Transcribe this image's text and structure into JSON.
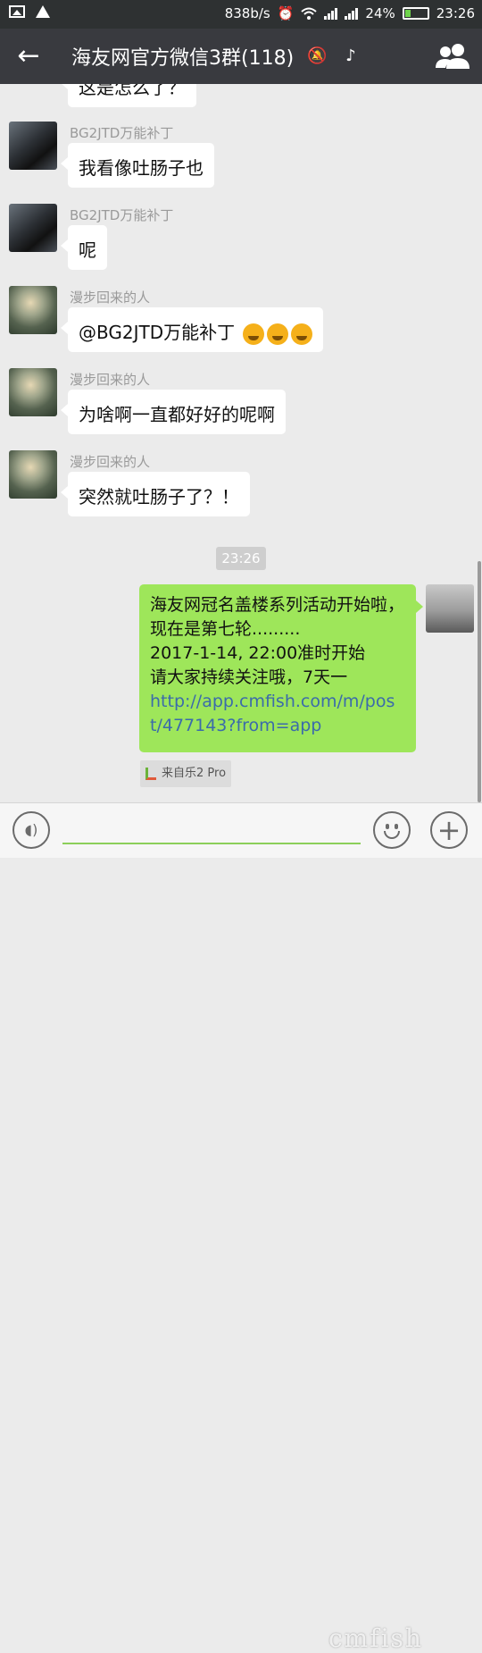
{
  "status_bar": {
    "net_speed": "838b/s",
    "battery_percent": "24%",
    "battery_level": 0.24,
    "time": "23:26",
    "icons": [
      "image-icon",
      "warning-icon",
      "alarm-icon",
      "wifi-icon",
      "signal-icon",
      "signal-icon",
      "battery-icon"
    ],
    "battery_color": "#6fd44c"
  },
  "header": {
    "back_icon": "back-arrow-icon",
    "title": "海友网官方微信3群(118)",
    "mute_icon": "mute-bell-icon",
    "earpiece_icon": "earpiece-icon",
    "members_icon": "group-members-icon",
    "bar_color": "#393a3f"
  },
  "messages": [
    {
      "sender": "",
      "text": "这是怎么了？",
      "side": "left",
      "partial": true
    },
    {
      "sender": "BG2JTD万能补丁",
      "text": "我看像吐肠子也",
      "side": "left"
    },
    {
      "sender": "BG2JTD万能补丁",
      "text": "呢",
      "side": "left"
    },
    {
      "sender": "漫步回来的人",
      "text": "@BG2JTD万能补丁",
      "emojis": [
        "crying-laughing-emoji",
        "crying-laughing-emoji",
        "crying-laughing-emoji"
      ],
      "side": "left"
    },
    {
      "sender": "漫步回来的人",
      "text": "为啥啊一直都好好的呢啊",
      "side": "left"
    },
    {
      "sender": "漫步回来的人",
      "text": "突然就吐肠子了？！",
      "side": "left"
    }
  ],
  "time_divider": "23:26",
  "my_message": {
    "line1": "海友网冠名盖楼系列活动开始啦，现在是第七轮.........",
    "line2": "2017-1-14, 22:00准时开始",
    "line3": "请大家持续关注哦，7天一",
    "link": "http://app.cmfish.com/m/post/477143?from=app",
    "bubble_color": "#9ee65a"
  },
  "source_tag": "来自乐2 Pro",
  "input_bar": {
    "voice_icon": "voice-icon",
    "emoji_icon": "emoji-icon",
    "plus_icon": "plus-icon",
    "accent_color": "#8ccf5a"
  },
  "watermark": "cmfish"
}
